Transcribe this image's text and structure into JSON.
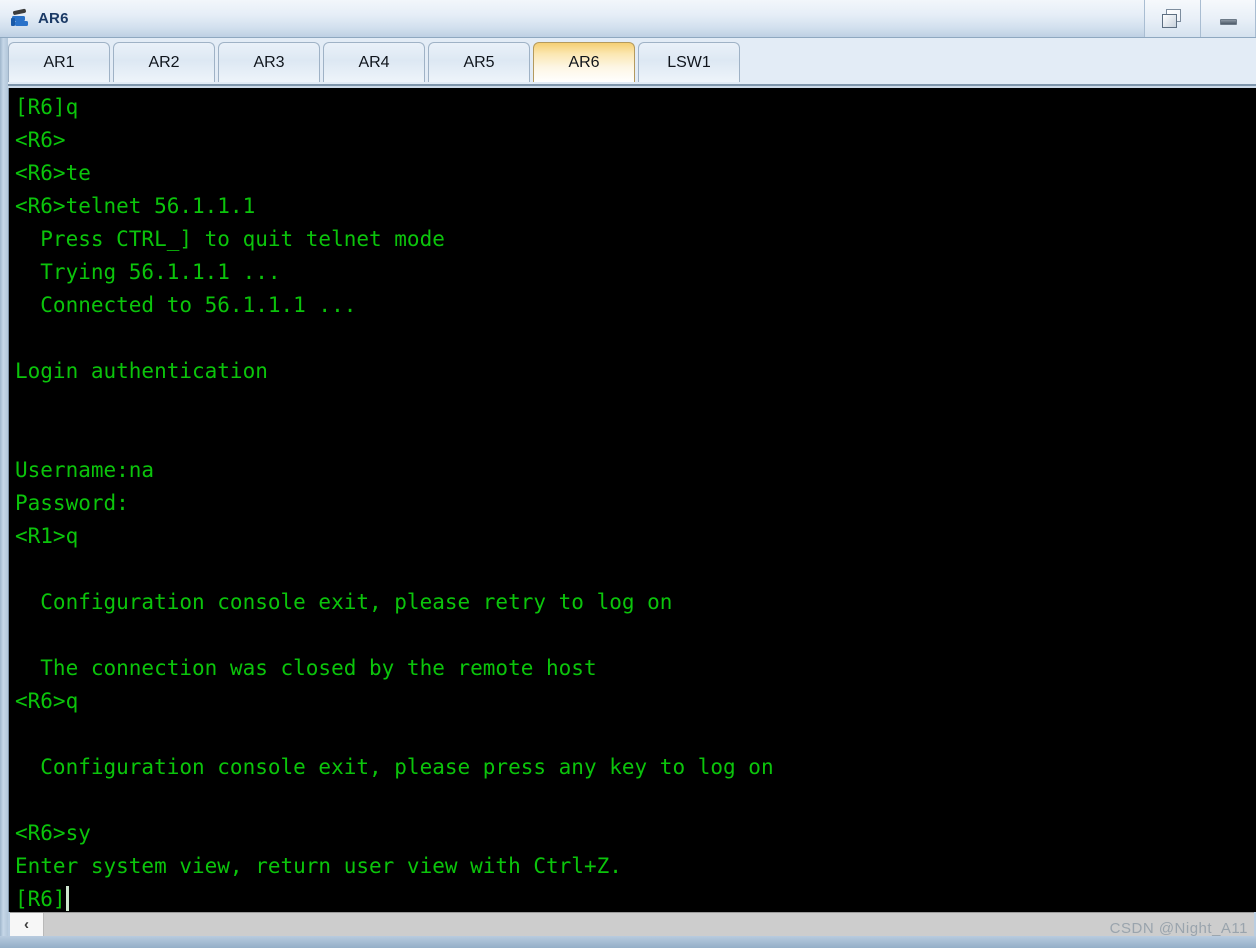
{
  "window": {
    "title": "AR6",
    "icon": "router-icon",
    "controls": [
      {
        "name": "restore-button",
        "icon": "restore-icon",
        "label": ""
      },
      {
        "name": "minimize-button",
        "icon": "minimize-icon",
        "label": ""
      }
    ]
  },
  "tabs": [
    {
      "label": "AR1",
      "active": false
    },
    {
      "label": "AR2",
      "active": false
    },
    {
      "label": "AR3",
      "active": false
    },
    {
      "label": "AR4",
      "active": false
    },
    {
      "label": "AR5",
      "active": false
    },
    {
      "label": "AR6",
      "active": true
    },
    {
      "label": "LSW1",
      "active": false
    }
  ],
  "terminal": {
    "lines": [
      "[R6]q",
      "<R6>",
      "<R6>te",
      "<R6>telnet 56.1.1.1",
      "  Press CTRL_] to quit telnet mode",
      "  Trying 56.1.1.1 ...",
      "  Connected to 56.1.1.1 ...",
      "",
      "Login authentication",
      "",
      "",
      "Username:na",
      "Password:",
      "<R1>q",
      "",
      "  Configuration console exit, please retry to log on",
      "",
      "  The connection was closed by the remote host",
      "<R6>q",
      "",
      "  Configuration console exit, please press any key to log on",
      "",
      "<R6>sy",
      "Enter system view, return user view with Ctrl+Z.",
      "[R6]"
    ],
    "prompt_cursor": true,
    "foreground_color": "#0bc40b",
    "background_color": "#000000"
  },
  "scrollbar": {
    "left_arrow_label": "‹"
  },
  "watermark": {
    "text": "CSDN @Night_A11"
  }
}
